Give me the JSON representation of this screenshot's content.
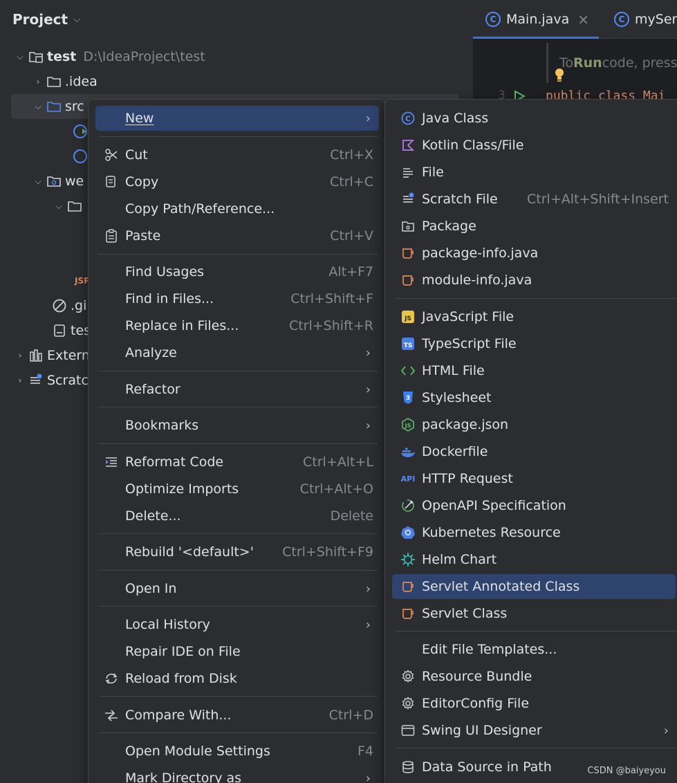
{
  "project": {
    "header": "Project",
    "tree": [
      {
        "label": "test",
        "path": "D:\\IdeaProject\\test"
      },
      {
        "label": ".idea"
      },
      {
        "label": "src"
      },
      {
        "label": "we"
      },
      {
        "label": ".gi"
      },
      {
        "label": "tes"
      },
      {
        "label": "Extern"
      },
      {
        "label": "Scratc"
      }
    ],
    "jsp_badge": "JSP"
  },
  "editor": {
    "tabs": [
      {
        "label": "Main.java"
      },
      {
        "label": "myServ"
      }
    ],
    "hint_prefix": "To ",
    "hint_run": "Run",
    "hint_suffix": " code, press",
    "line_number": "3",
    "code": "public class Mai"
  },
  "context_menu": {
    "new": "New",
    "cut": "Cut",
    "cut_sc": "Ctrl+X",
    "copy": "Copy",
    "copy_sc": "Ctrl+C",
    "copy_path": "Copy Path/Reference...",
    "paste": "Paste",
    "paste_sc": "Ctrl+V",
    "find_usages": "Find Usages",
    "find_usages_sc": "Alt+F7",
    "find_files": "Find in Files...",
    "find_files_sc": "Ctrl+Shift+F",
    "replace_files": "Replace in Files...",
    "replace_files_sc": "Ctrl+Shift+R",
    "analyze": "Analyze",
    "refactor": "Refactor",
    "bookmarks": "Bookmarks",
    "reformat": "Reformat Code",
    "reformat_sc": "Ctrl+Alt+L",
    "optimize": "Optimize Imports",
    "optimize_sc": "Ctrl+Alt+O",
    "delete": "Delete...",
    "delete_sc": "Delete",
    "rebuild": "Rebuild '<default>'",
    "rebuild_sc": "Ctrl+Shift+F9",
    "open_in": "Open In",
    "local_history": "Local History",
    "repair": "Repair IDE on File",
    "reload": "Reload from Disk",
    "compare": "Compare With...",
    "compare_sc": "Ctrl+D",
    "module_settings": "Open Module Settings",
    "module_settings_sc": "F4",
    "mark_dir": "Mark Directory as"
  },
  "new_submenu": {
    "java_class": "Java Class",
    "kotlin": "Kotlin Class/File",
    "file": "File",
    "scratch": "Scratch File",
    "scratch_sc": "Ctrl+Alt+Shift+Insert",
    "package": "Package",
    "package_info": "package-info.java",
    "module_info": "module-info.java",
    "js": "JavaScript File",
    "ts": "TypeScript File",
    "html": "HTML File",
    "stylesheet": "Stylesheet",
    "package_json": "package.json",
    "dockerfile": "Dockerfile",
    "http": "HTTP Request",
    "openapi": "OpenAPI Specification",
    "k8s": "Kubernetes Resource",
    "helm": "Helm Chart",
    "servlet_annotated": "Servlet Annotated Class",
    "servlet_class": "Servlet Class",
    "edit_templates": "Edit File Templates...",
    "resource_bundle": "Resource Bundle",
    "editorconfig": "EditorConfig File",
    "swing": "Swing UI Designer",
    "datasource": "Data Source in Path"
  },
  "watermark": "CSDN @baiyeyou",
  "colors": {
    "background": "#2b2d30",
    "selection": "#2e436e",
    "accent": "#3574f0"
  }
}
